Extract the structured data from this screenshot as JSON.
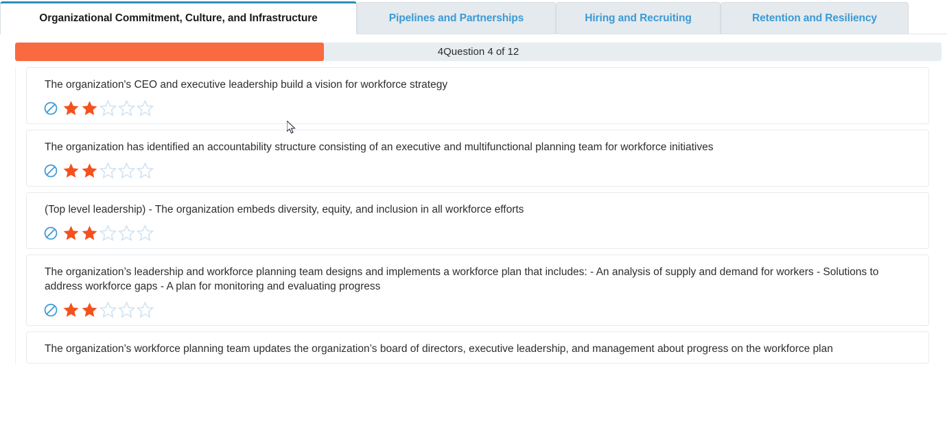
{
  "colors": {
    "accent_orange": "#f96a41",
    "tab_blue": "#3b9ad4",
    "active_tab_border": "#2b8cbe",
    "star_filled": "#f4511e",
    "star_empty": "#cfe2f1",
    "ban_icon": "#3b9ad4",
    "progress_track": "#e8edf0"
  },
  "tabs": [
    {
      "label": "Organizational Commitment, Culture, and Infrastructure",
      "active": true
    },
    {
      "label": "Pipelines and Partnerships",
      "active": false
    },
    {
      "label": "Hiring and Recruiting",
      "active": false
    },
    {
      "label": "Retention and Resiliency",
      "active": false
    }
  ],
  "progress": {
    "label": "4Question 4 of 12",
    "current": 4,
    "total": 12,
    "percent": "33.3%"
  },
  "rating_scale": {
    "max_stars": 5,
    "not_applicable_icon": "ban-icon",
    "star_icon": "star-icon"
  },
  "questions": [
    {
      "text": "The organization's CEO and executive leadership build a vision for workforce strategy",
      "rating": 2
    },
    {
      "text": "The organization has identified an accountability structure consisting of an executive and multifunctional planning team for workforce initiatives",
      "rating": 2
    },
    {
      "text": "(Top level leadership) - The organization embeds diversity, equity, and inclusion in all workforce efforts",
      "rating": 2
    },
    {
      "text": "The organization’s leadership and workforce planning team designs and implements a workforce plan that includes: - An analysis of supply and demand for workers - Solutions to address workforce gaps - A plan for monitoring and evaluating progress",
      "rating": 2
    },
    {
      "text": "The organization’s workforce planning team updates the organization’s board of directors, executive leadership, and management about progress on the workforce plan",
      "rating": 0
    }
  ]
}
